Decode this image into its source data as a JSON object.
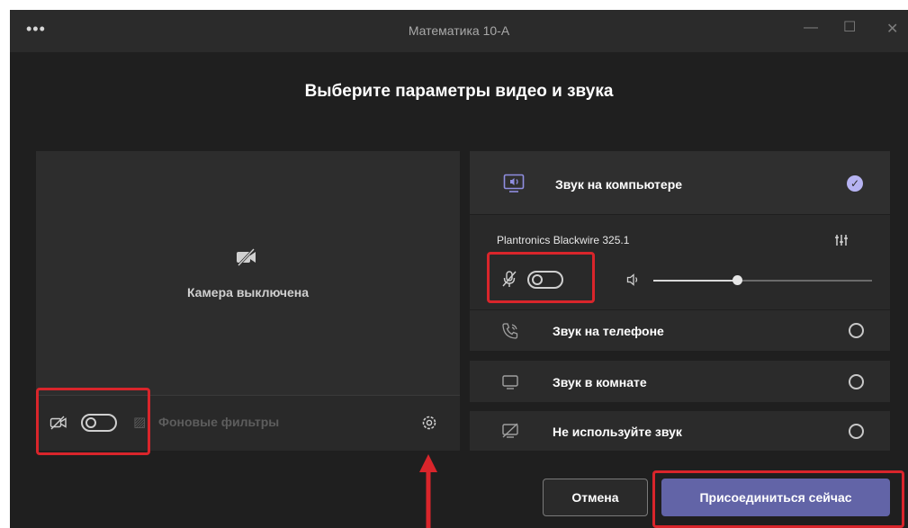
{
  "window": {
    "title": "Математика 10-А",
    "menu_icon": "ellipsis-icon"
  },
  "heading": "Выберите параметры видео и звука",
  "preview": {
    "camera_status": "Камера выключена",
    "filters_label": "Фоновые фильтры",
    "camera_toggle_on": false
  },
  "audio_options": [
    {
      "label": "Звук на компьютере",
      "icon": "computer-audio-icon",
      "selected": true
    },
    {
      "label": "Звук на телефоне",
      "icon": "phone-audio-icon",
      "selected": false
    },
    {
      "label": "Звук в комнате",
      "icon": "room-audio-icon",
      "selected": false
    },
    {
      "label": "Не используйте звук",
      "icon": "no-audio-icon",
      "selected": false
    }
  ],
  "device": {
    "name": "Plantronics Blackwire 325.1",
    "mic_toggle_on": false,
    "volume_level": 0.38
  },
  "buttons": {
    "cancel": "Отмена",
    "join": "Присоединиться сейчас"
  },
  "colors": {
    "accent": "#6264a7",
    "highlight": "#d9252b",
    "check": "#b6b3f2"
  }
}
